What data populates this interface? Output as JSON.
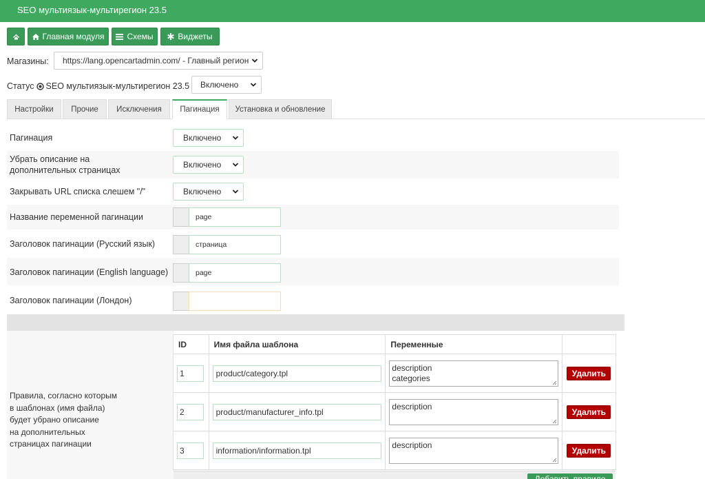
{
  "header": {
    "title": "SEO мультиязык-мультирегион 23.5"
  },
  "toolbar": {
    "home_label": "",
    "main_label": "Главная модуля",
    "schemes_label": "Схемы",
    "widgets_label": "Виджеты"
  },
  "store": {
    "label": "Магазины:",
    "value": "https://lang.opencartadmin.com/ - Главный регион"
  },
  "status": {
    "label_prefix": "Статус",
    "label_suffix": "SEO мультиязык-мультирегион 23.5",
    "value": "Включено"
  },
  "tabs": [
    {
      "label": "Настройки"
    },
    {
      "label": "Прочие"
    },
    {
      "label": "Исключения"
    },
    {
      "label": "Пагинация"
    },
    {
      "label": "Установка и обновление"
    }
  ],
  "settings": {
    "pagination": {
      "label": "Пагинация",
      "value": "Включено"
    },
    "remove_desc": {
      "label1": "Убрать описание на",
      "label2": "дополнительных страницах",
      "value": "Включено"
    },
    "close_url": {
      "label": "Закрывать URL списка слешем \"/\"",
      "value": "Включено"
    },
    "var_name": {
      "label": "Название переменной пагинации",
      "value": "page"
    },
    "title_ru": {
      "label": "Заголовок пагинации (Русский язык)",
      "value": "страница"
    },
    "title_en": {
      "label": "Заголовок пагинации (English language)",
      "value": "page"
    },
    "title_london": {
      "label": "Заголовок пагинации (Лондон)",
      "value": ""
    }
  },
  "rules": {
    "label_lines": [
      "Правила, согласно которым",
      "в шаблонах (имя файла)",
      "будет убрано описание",
      "на дополнительных",
      "страницах пагинации"
    ],
    "columns": {
      "id": "ID",
      "file": "Имя файла шаблона",
      "vars": "Переменные"
    },
    "delete_label": "Удалить",
    "add_label": "Добавить правило",
    "rows": [
      {
        "id": "1",
        "file": "product/category.tpl",
        "vars1": "description",
        "vars2": "categories"
      },
      {
        "id": "2",
        "file": "product/manufacturer_info.tpl",
        "vars1": "description",
        "vars2": ""
      },
      {
        "id": "3",
        "file": "information/information.tpl",
        "vars1": "description",
        "vars2": ""
      }
    ]
  },
  "colors": {
    "accent": "#3faa5f",
    "danger": "#b30000"
  },
  "icons": [
    "home-icon",
    "bars-icon",
    "asterisk-icon",
    "chevron-down-icon",
    "circle-check-icon"
  ]
}
